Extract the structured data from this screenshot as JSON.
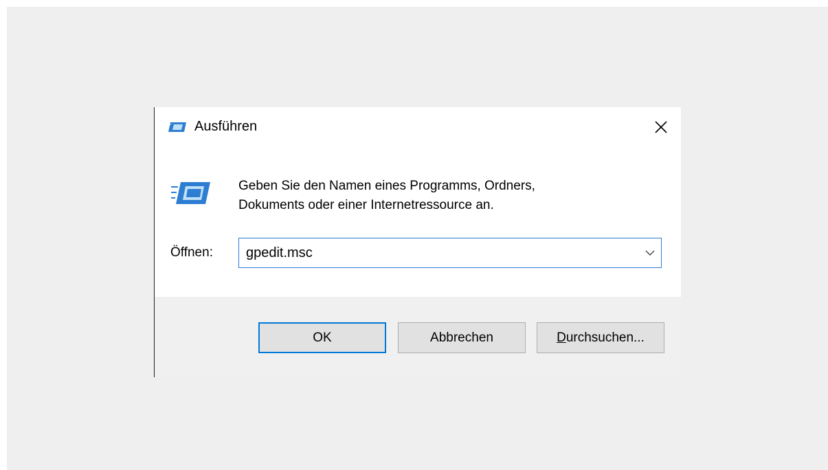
{
  "window": {
    "title": "Ausführen",
    "close_icon": "close-icon",
    "app_icon": "run-icon"
  },
  "dialog": {
    "description_line1": "Geben Sie den Namen eines Programms, Ordners,",
    "description_line2": "Dokuments oder einer Internetressource an.",
    "open_label": "Öffnen:",
    "input_value": "gpedit.msc",
    "dropdown_icon": "chevron-down-icon"
  },
  "buttons": {
    "ok": "OK",
    "cancel": "Abbrechen",
    "browse_first": "D",
    "browse_rest": "urchsuchen..."
  },
  "colors": {
    "focus_accent": "#0078d7",
    "dialog_background": "#f0f0f0",
    "content_background": "#ffffff"
  }
}
